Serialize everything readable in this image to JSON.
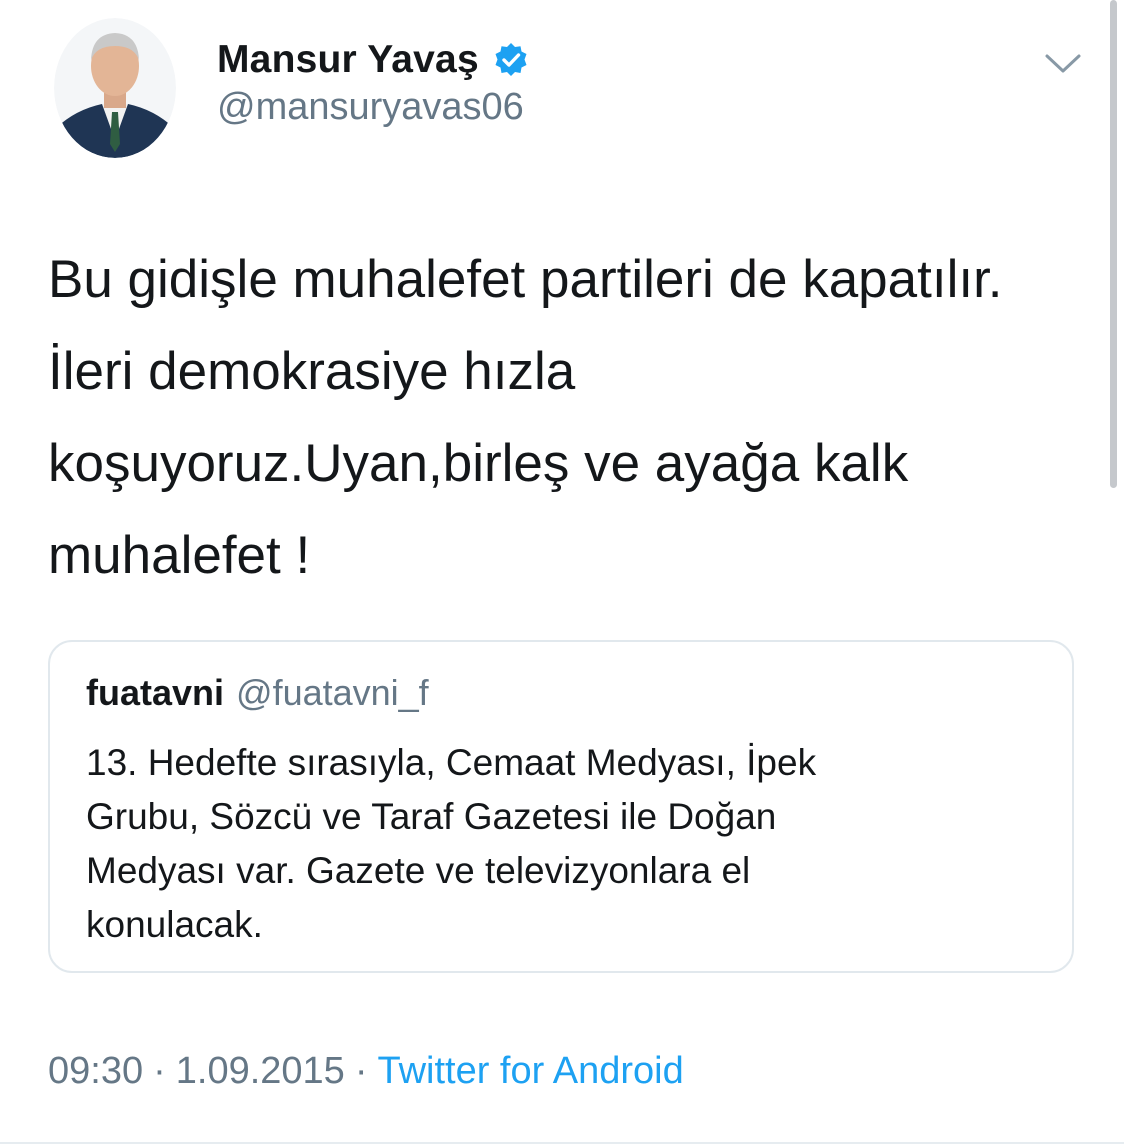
{
  "author": {
    "display_name": "Mansur Yavaş",
    "handle": "@mansuryavas06",
    "verified": true,
    "avatar_icon": "profile-photo"
  },
  "tweet": {
    "lines": [
      "Bu gidişle muhalefet partileri de kapatılır.",
      "İleri demokrasiye hızla",
      "koşuyoruz.Uyan,birleş ve ayağa kalk",
      "muhalefet !"
    ]
  },
  "quoted_tweet": {
    "display_name": "fuatavni",
    "handle": "@fuatavni_f",
    "lines": [
      "13. Hedefte sırasıyla, Cemaat Medyası, İpek",
      "Grubu, Sözcü ve Taraf Gazetesi ile Doğan",
      "Medyası var. Gazete ve televizyonlara el",
      "konulacak."
    ]
  },
  "meta": {
    "time": "09:30",
    "separator": "·",
    "date": "1.09.2015",
    "source": "Twitter for Android"
  },
  "icons": {
    "verified": "verified-badge-icon",
    "menu": "chevron-down-icon"
  },
  "colors": {
    "text": "#14171a",
    "secondary": "#657786",
    "link": "#1da1f2",
    "border": "#e1e8ed"
  }
}
